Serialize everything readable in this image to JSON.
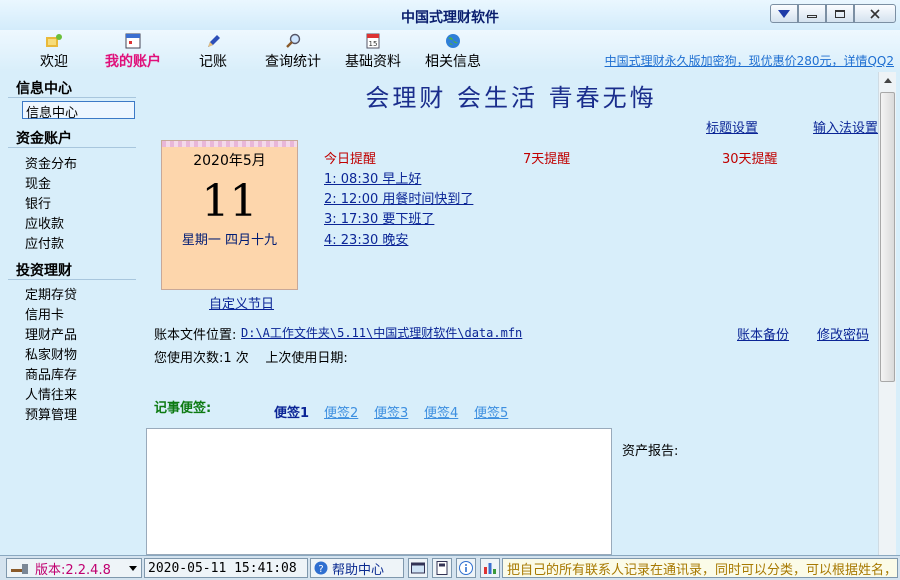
{
  "window": {
    "title": "中国式理财软件"
  },
  "toolbar": {
    "items": [
      {
        "label": "欢迎",
        "icon": "welcome-icon"
      },
      {
        "label": "我的账户",
        "icon": "account-icon",
        "active": true
      },
      {
        "label": "记账",
        "icon": "pen-icon"
      },
      {
        "label": "查询统计",
        "icon": "magnifier-icon"
      },
      {
        "label": "基础资料",
        "icon": "calendar-icon"
      },
      {
        "label": "相关信息",
        "icon": "globe-icon"
      }
    ],
    "promo": "中国式理财永久版加密狗，现优惠价280元，详情QQ2"
  },
  "sidebar": {
    "info": {
      "title": "信息中心",
      "items": [
        "信息中心"
      ]
    },
    "funds": {
      "title": "资金账户",
      "items": [
        "资金分布",
        "现金",
        "银行",
        "应收款",
        "应付款"
      ]
    },
    "invest": {
      "title": "投资理财",
      "items": [
        "定期存贷",
        "信用卡",
        "理财产品",
        "私家财物",
        "商品库存",
        "人情往来",
        "预算管理"
      ]
    }
  },
  "main": {
    "slogan": "会理财 会生活 青春无悔",
    "title_settings": "标题设置",
    "ime_settings": "输入法设置",
    "calendar": {
      "month": "2020年5月",
      "day": "11",
      "week": "星期一 四月十九"
    },
    "custom_holiday": "自定义节日",
    "reminders": {
      "today": "今日提醒",
      "week": "7天提醒",
      "month": "30天提醒",
      "items": [
        "1: 08:30 早上好",
        "2: 12:00 用餐时间快到了",
        "3: 17:30 要下班了",
        "4: 23:30 晚安"
      ]
    },
    "file_label": "账本文件位置:",
    "file_path": "D:\\A工作文件夹\\5.11\\中国式理财软件\\data.mfn",
    "backup": "账本备份",
    "change_password": "修改密码",
    "usage": "您使用次数:1 次    上次使用日期:",
    "notes_label": "记事便签:",
    "note_tabs": [
      "便签1",
      "便签2",
      "便签3",
      "便签4",
      "便签5"
    ],
    "asset_report": "资产报告:"
  },
  "statusbar": {
    "version": "版本:2.2.4.8",
    "datetime": "2020-05-11 15:41:08",
    "help": "帮助中心",
    "tip": "把自己的所有联系人记录在通讯录，同时可以分类，可以根据姓名，电话,"
  }
}
